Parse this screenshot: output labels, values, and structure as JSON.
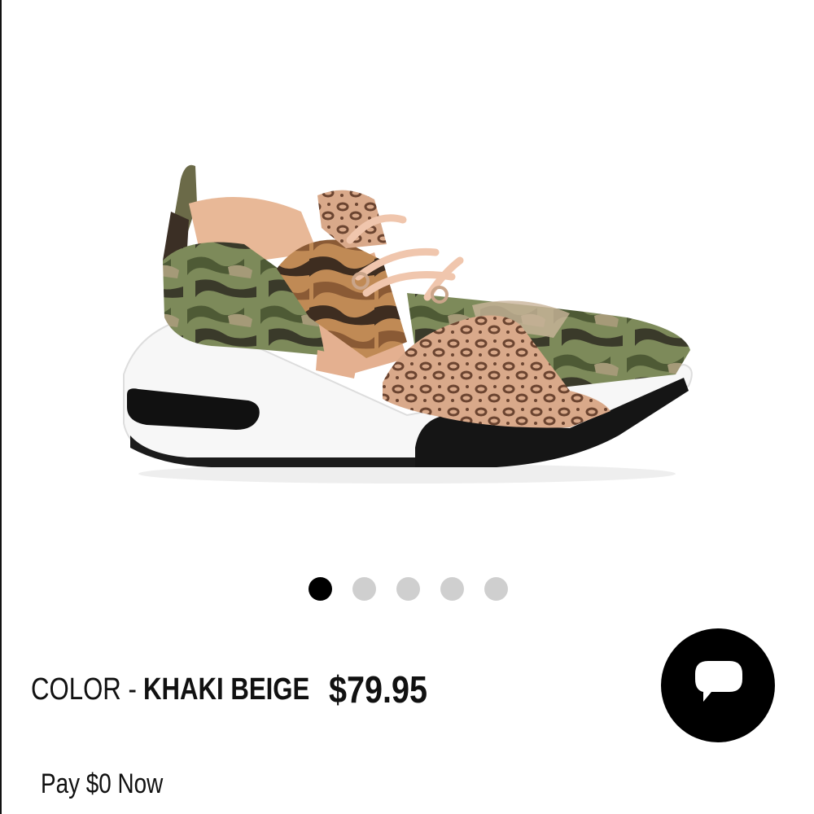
{
  "product": {
    "image_alt": "sneaker",
    "color_label": "COLOR -",
    "color_value": "KHAKI BEIGE",
    "price": "$79.95"
  },
  "carousel": {
    "total": 5,
    "active_index": 0,
    "active_color": "#000000",
    "inactive_color": "#cfcfcf"
  },
  "payment": {
    "pay_now_label": "Pay $0 Now"
  },
  "chat": {
    "icon": "chat-bubble-icon",
    "color": "#000000"
  }
}
